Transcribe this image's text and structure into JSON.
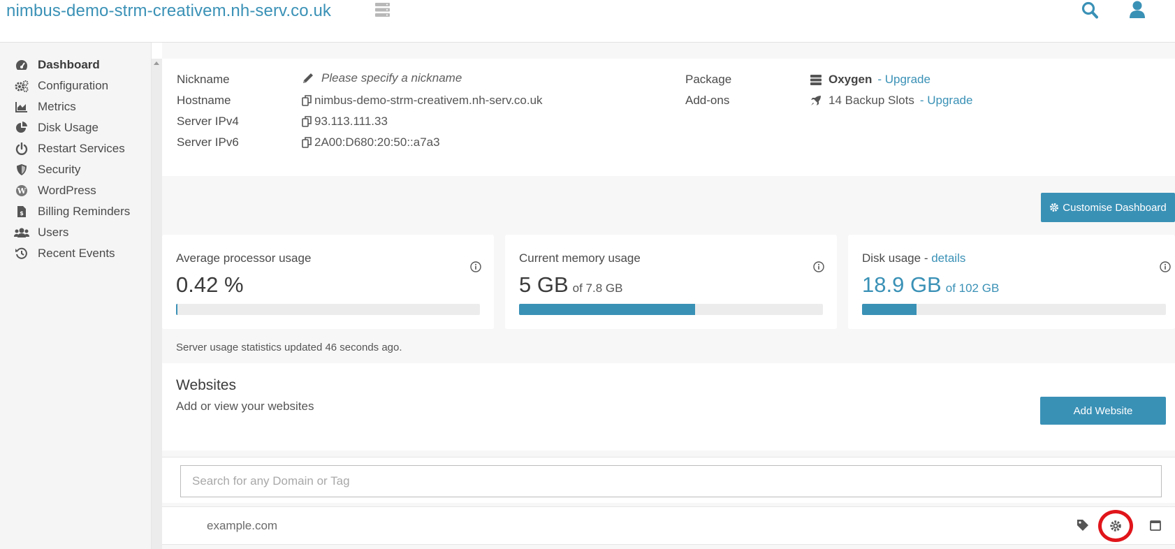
{
  "header": {
    "title": "nimbus-demo-strm-creativem.nh-serv.co.uk",
    "icons": [
      "server-icon",
      "search-icon",
      "user-icon"
    ]
  },
  "sidebar": {
    "items": [
      {
        "label": "Dashboard",
        "icon": "tachometer-icon",
        "active": true
      },
      {
        "label": "Configuration",
        "icon": "cogs-icon"
      },
      {
        "label": "Metrics",
        "icon": "area-chart-icon"
      },
      {
        "label": "Disk Usage",
        "icon": "pie-chart-icon"
      },
      {
        "label": "Restart Services",
        "icon": "power-icon"
      },
      {
        "label": "Security",
        "icon": "shield-icon"
      },
      {
        "label": "WordPress",
        "icon": "wordpress-icon"
      },
      {
        "label": "Billing Reminders",
        "icon": "invoice-icon"
      },
      {
        "label": "Users",
        "icon": "users-icon"
      },
      {
        "label": "Recent Events",
        "icon": "history-icon"
      }
    ]
  },
  "server_info": {
    "nickname_label": "Nickname",
    "nickname_value": "Please specify a nickname",
    "hostname_label": "Hostname",
    "hostname_value": "nimbus-demo-strm-creativem.nh-serv.co.uk",
    "ipv4_label": "Server IPv4",
    "ipv4_value": "93.113.111.33",
    "ipv6_label": "Server IPv6",
    "ipv6_value": "2A00:D680:20:50::a7a3",
    "package_label": "Package",
    "package_value": "Oxygen",
    "package_upgrade": "- Upgrade",
    "addons_label": "Add-ons",
    "addons_value": "14 Backup Slots",
    "addons_upgrade": "- Upgrade"
  },
  "dashboard": {
    "customise_label": "Customise Dashboard",
    "cards": {
      "cpu": {
        "title": "Average processor usage",
        "value": "0.42 %",
        "fraction": 0.0042
      },
      "memory": {
        "title": "Current memory usage",
        "value": "5 GB",
        "of": "of 7.8 GB",
        "fraction": 0.58
      },
      "disk": {
        "title": "Disk usage",
        "title_link": "details",
        "title_sep": " - ",
        "value": "18.9 GB",
        "of": "of 102 GB",
        "fraction": 0.18
      }
    },
    "updated": "Server usage statistics updated 46 seconds ago."
  },
  "websites": {
    "title": "Websites",
    "subtitle": "Add or view your websites",
    "add_label": "Add Website",
    "search_placeholder": "Search for any Domain or Tag",
    "rows": [
      {
        "domain": "example.com"
      }
    ]
  },
  "colors": {
    "accent": "#3a91b6",
    "highlight_ring": "#e0151b"
  }
}
